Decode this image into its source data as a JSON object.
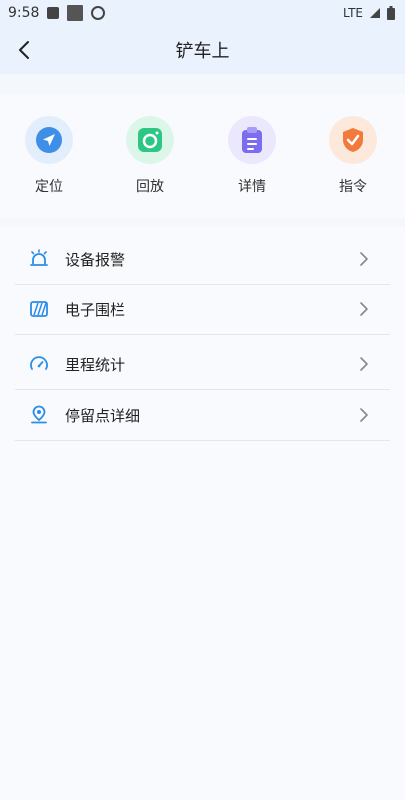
{
  "status_bar": {
    "time": "9:58",
    "network": "LTE"
  },
  "header": {
    "title": "铲车上"
  },
  "shortcuts": [
    {
      "label": "定位",
      "icon": "navigation-arrow-icon",
      "color": "#3d8fe8",
      "bg": "#e3eefc"
    },
    {
      "label": "回放",
      "icon": "camera-icon",
      "color": "#2cc784",
      "bg": "#dcf6ea"
    },
    {
      "label": "详情",
      "icon": "clipboard-icon",
      "color": "#7b6cf0",
      "bg": "#ebe8fd"
    },
    {
      "label": "指令",
      "icon": "shield-check-icon",
      "color": "#f27a3b",
      "bg": "#fde8dc"
    }
  ],
  "menu": [
    {
      "label": "设备报警",
      "icon": "alarm-bell-icon"
    },
    {
      "label": "电子围栏",
      "icon": "fence-icon"
    },
    {
      "label": "里程统计",
      "icon": "speedometer-icon"
    },
    {
      "label": "停留点详细",
      "icon": "location-pin-icon"
    }
  ],
  "accent_color": "#2b8de8"
}
